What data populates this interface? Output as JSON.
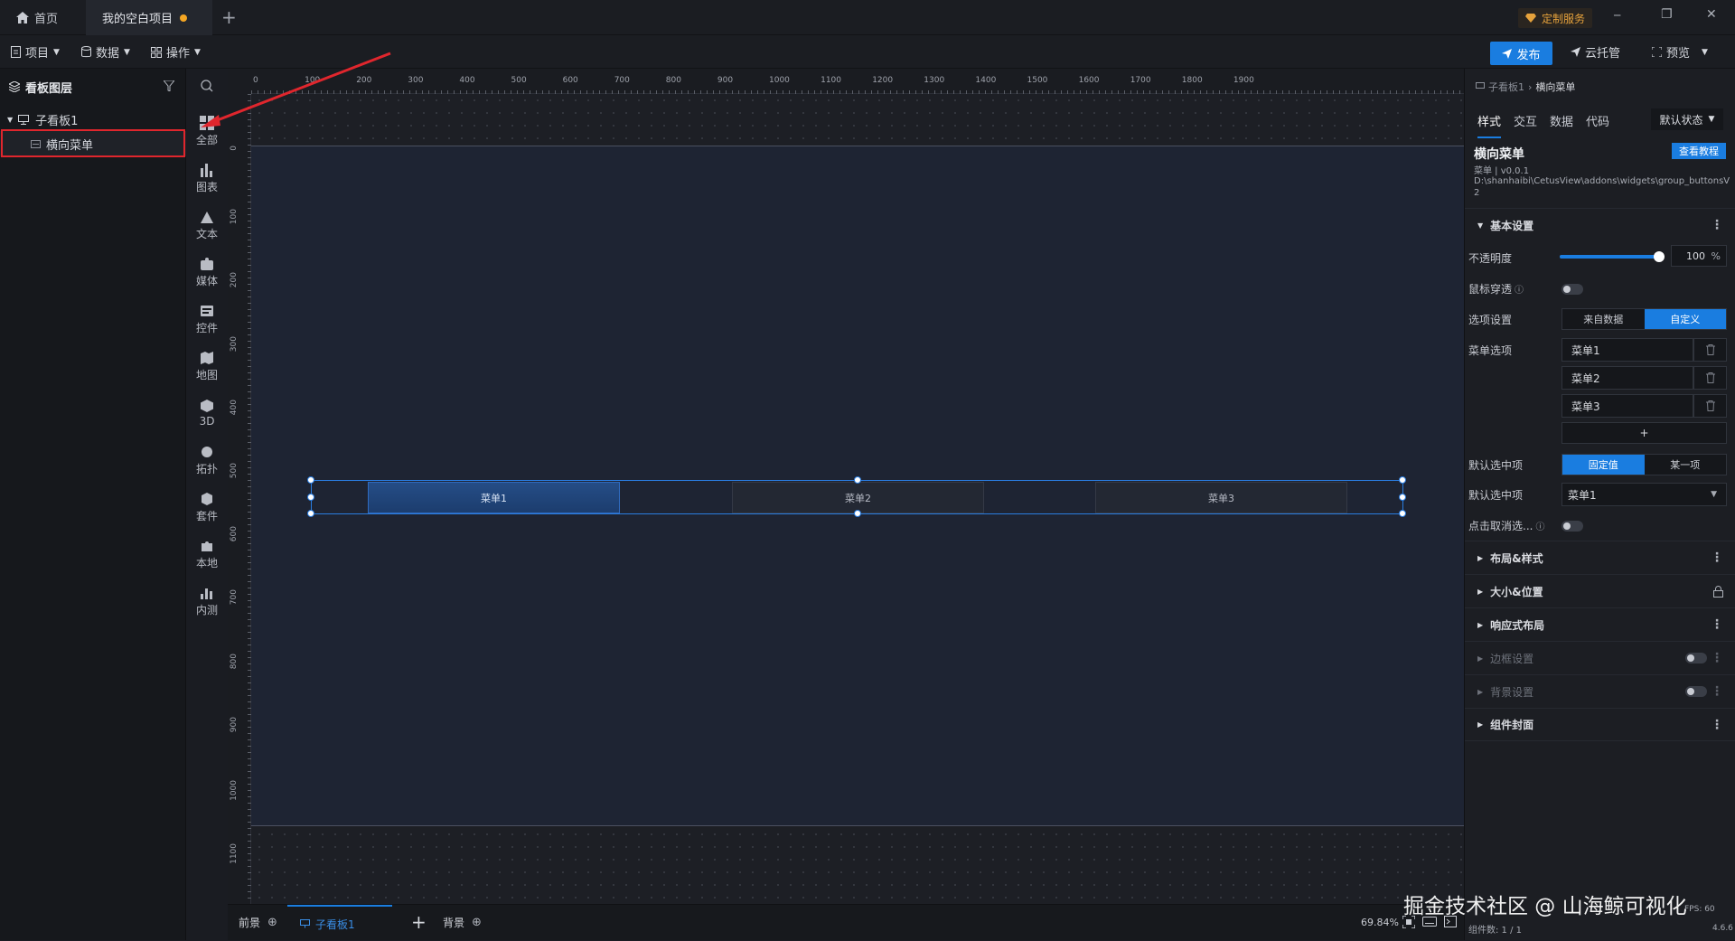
{
  "titlebar": {
    "tabs": [
      {
        "label": "首页"
      },
      {
        "label": "我的空白项目"
      }
    ],
    "service_label": "定制服务",
    "add_tab": "+",
    "window_controls": {
      "minimize": "─",
      "restore": "❐",
      "close": "✕"
    }
  },
  "toolbar": {
    "menus": [
      {
        "label": "项目"
      },
      {
        "label": "数据"
      },
      {
        "label": "操作"
      }
    ],
    "publish_label": "发布",
    "cloud_label": "云托管",
    "preview_label": "预览"
  },
  "layers": {
    "title": "看板图层",
    "tree": [
      {
        "label": "子看板1"
      },
      {
        "label": "横向菜单"
      }
    ]
  },
  "components": [
    {
      "label": "全部",
      "icon": "grid-icon"
    },
    {
      "label": "图表",
      "icon": "bar-chart-icon"
    },
    {
      "label": "文本",
      "icon": "text-icon"
    },
    {
      "label": "媒体",
      "icon": "media-icon"
    },
    {
      "label": "控件",
      "icon": "control-icon"
    },
    {
      "label": "地图",
      "icon": "map-icon"
    },
    {
      "label": "3D",
      "icon": "cube-icon"
    },
    {
      "label": "拓扑",
      "icon": "topology-icon"
    },
    {
      "label": "套件",
      "icon": "kit-icon"
    },
    {
      "label": "本地",
      "icon": "puzzle-icon"
    },
    {
      "label": "内测",
      "icon": "beta-icon"
    }
  ],
  "rulers": {
    "top": [
      "0",
      "100",
      "200",
      "300",
      "400",
      "500",
      "600",
      "700",
      "800",
      "900",
      "1000",
      "1100",
      "1200",
      "1300",
      "1400",
      "1500",
      "1600",
      "1700",
      "1800",
      "1900"
    ],
    "left": [
      "0",
      "100",
      "200",
      "300",
      "400",
      "500",
      "600",
      "700",
      "800",
      "900",
      "1000",
      "1100",
      "1200"
    ]
  },
  "canvas": {
    "menu_items": [
      "菜单1",
      "菜单2",
      "菜单3"
    ]
  },
  "bottombar": {
    "front_label": "前景",
    "board_tab": "子看板1",
    "back_label": "背景",
    "zoom": "69.84%",
    "component_count": "组件数: 1 / 1",
    "version": "4.6.6",
    "fps": "FPS: 60"
  },
  "props": {
    "breadcrumb": [
      "子看板1",
      "横向菜单"
    ],
    "tabs": [
      "样式",
      "交互",
      "数据",
      "代码"
    ],
    "state_select": "默认状态",
    "widget_name": "横向菜单",
    "widget_meta": "菜单 | v0.0.1",
    "widget_path": "D:\\shanhaibi\\CetusView\\addons\\widgets\\group_buttonsV2",
    "tutorial_button": "查看教程",
    "basic_section": "基本设置",
    "opacity_label": "不透明度",
    "opacity_value": "100",
    "opacity_unit": "%",
    "opacity_fraction": 1.0,
    "mouse_through_label": "鼠标穿透",
    "option_setting_label": "选项设置",
    "option_from_data": "来自数据",
    "option_custom": "自定义",
    "menu_options_label": "菜单选项",
    "menu_options": [
      "菜单1",
      "菜单2",
      "菜单3"
    ],
    "add_option": "+",
    "default_selected_label": "默认选中项",
    "fixed_value": "固定值",
    "some_item": "某一项",
    "default_selected_label2": "默认选中项",
    "default_selected_value": "菜单1",
    "click_cancel_label": "点击取消选...",
    "sections": [
      {
        "label": "布局&样式",
        "disabled": false
      },
      {
        "label": "大小&位置",
        "disabled": false
      },
      {
        "label": "响应式布局",
        "disabled": false
      },
      {
        "label": "边框设置",
        "disabled": true
      },
      {
        "label": "背景设置",
        "disabled": true
      },
      {
        "label": "组件封面",
        "disabled": false
      }
    ]
  },
  "colors": {
    "accent": "#1a7de0",
    "highlight_box": "#e0262d",
    "arrow": "#e0262d",
    "canvas_board": "#1e2433"
  },
  "watermark": "掘金技术社区 @ 山海鲸可视化"
}
